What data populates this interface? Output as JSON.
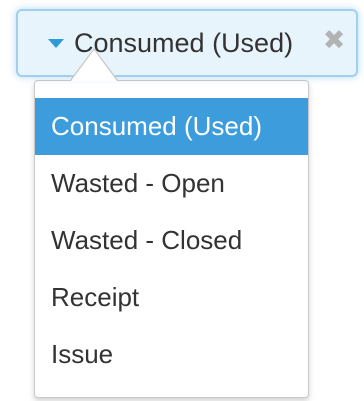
{
  "select": {
    "value": "Consumed (Used)",
    "clear_glyph": "✖",
    "caret_icon": "caret-down-icon",
    "accent_color": "#2e9ad8"
  },
  "dropdown": {
    "highlight_color": "#3c9cdc",
    "options": [
      {
        "label": "Consumed (Used)",
        "highlighted": true
      },
      {
        "label": "Wasted - Open",
        "highlighted": false
      },
      {
        "label": "Wasted - Closed",
        "highlighted": false
      },
      {
        "label": "Receipt",
        "highlighted": false
      },
      {
        "label": "Issue",
        "highlighted": false
      }
    ]
  }
}
